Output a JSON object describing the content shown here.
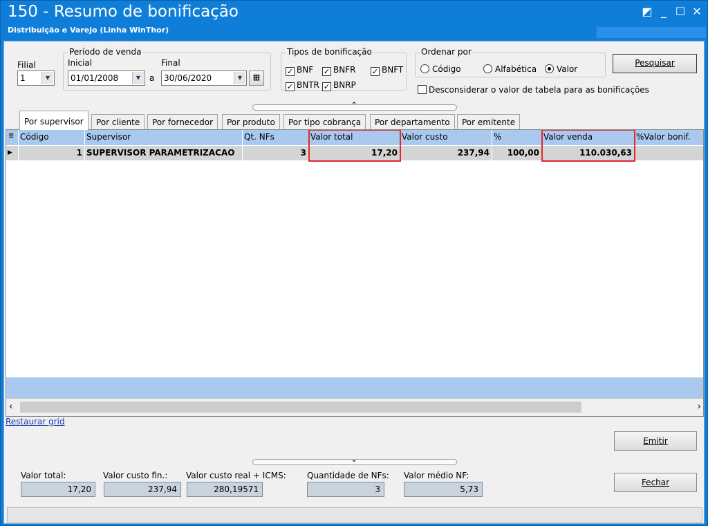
{
  "window": {
    "title": "150 - Resumo de bonificação",
    "subtitle": "Distribuição e Varejo (Linha WinThor)"
  },
  "filters": {
    "filial_label": "Filial",
    "filial_value": "1",
    "periodo_label": "Período de venda",
    "inicial_label": "Inicial",
    "inicial_value": "01/01/2008",
    "a_label": "a",
    "final_label": "Final",
    "final_value": "30/06/2020",
    "tipos_label": "Tipos de bonificação",
    "tipos": [
      {
        "label": "BNF",
        "checked": true
      },
      {
        "label": "BNFR",
        "checked": true
      },
      {
        "label": "BNFT",
        "checked": true
      },
      {
        "label": "BNTR",
        "checked": true
      },
      {
        "label": "BNRP",
        "checked": true
      }
    ],
    "ordenar_label": "Ordenar por",
    "ordenar_options": [
      {
        "label": "Código",
        "selected": false
      },
      {
        "label": "Alfabética",
        "selected": false
      },
      {
        "label": "Valor",
        "selected": true
      }
    ],
    "desconsiderar_label": "Desconsiderar o valor de tabela para as bonificações",
    "desconsiderar_checked": false,
    "pesquisar_label": "Pesquisar"
  },
  "tabs": [
    {
      "label": "Por supervisor",
      "active": true
    },
    {
      "label": "Por cliente",
      "active": false
    },
    {
      "label": "Por fornecedor",
      "active": false
    },
    {
      "label": "Por produto",
      "active": false
    },
    {
      "label": "Por tipo cobrança",
      "active": false
    },
    {
      "label": "Por departamento",
      "active": false
    },
    {
      "label": "Por emitente",
      "active": false
    }
  ],
  "grid": {
    "columns": [
      "Código",
      "Supervisor",
      "Qt. NFs",
      "Valor total",
      "Valor custo",
      "%",
      "Valor venda",
      "%Valor bonif."
    ],
    "rows": [
      [
        "1",
        "SUPERVISOR PARAMETRIZACAO",
        "3",
        "17,20",
        "237,94",
        "100,00",
        "110.030,63",
        ""
      ]
    ],
    "highlighted_columns": [
      "Valor total",
      "Valor venda"
    ]
  },
  "restaurar_grid": "Restaurar grid",
  "buttons": {
    "emitir": "Emitir",
    "fechar": "Fechar"
  },
  "totals": {
    "valor_total_label": "Valor total:",
    "valor_total": "17,20",
    "valor_custo_fin_label": "Valor custo fin.:",
    "valor_custo_fin": "237,94",
    "valor_custo_real_label": "Valor custo real + ICMS:",
    "valor_custo_real": "280,19571",
    "quantidade_nfs_label": "Quantidade de NFs:",
    "quantidade_nfs": "3",
    "valor_medio_label": "Valor médio NF:",
    "valor_medio": "5,73"
  },
  "colors": {
    "titlebar": "#0f7ed9",
    "header": "#aac9ef",
    "highlight": "#e5262d"
  }
}
